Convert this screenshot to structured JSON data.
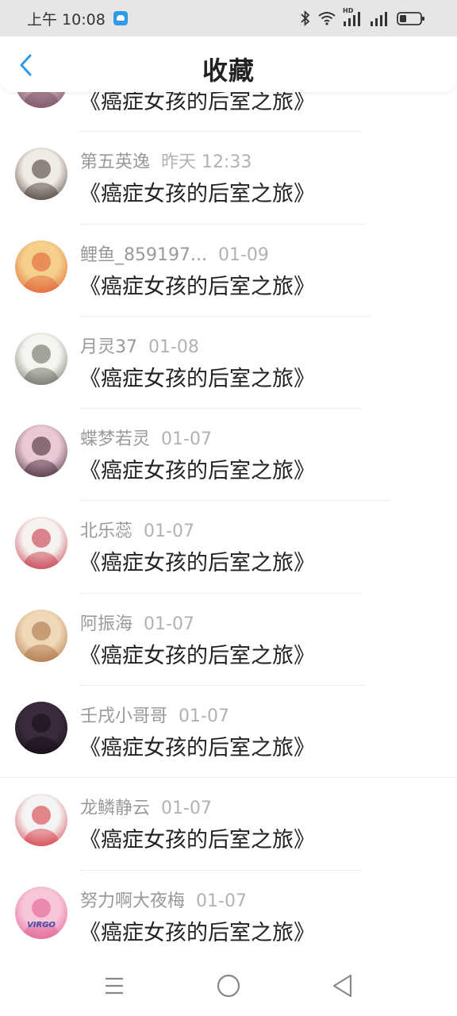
{
  "status_bar": {
    "time": "上午 10:08",
    "icons": [
      "app-notification-icon",
      "bluetooth-icon",
      "wifi-icon",
      "hd-signal-icon",
      "signal-icon",
      "battery-icon"
    ],
    "hd_label": "HD"
  },
  "header": {
    "title": "收藏",
    "back_icon": "chevron-left-icon",
    "accent_color": "#2f9be8"
  },
  "list": {
    "items": [
      {
        "user": "",
        "time": "",
        "title": "《癌症女孩的后室之旅》",
        "avatar_colors": [
          "#c9a6b6",
          "#6e4a5a"
        ]
      },
      {
        "user": "第五英逸",
        "time": "昨天 12:33",
        "title": "《癌症女孩的后室之旅》",
        "avatar_colors": [
          "#f1ebe6",
          "#3b2e2a"
        ]
      },
      {
        "user": "鲤鱼_859197...",
        "time": "01-09",
        "title": "《癌症女孩的后室之旅》",
        "avatar_colors": [
          "#f4d08a",
          "#e0582f"
        ]
      },
      {
        "user": "月灵37",
        "time": "01-08",
        "title": "《癌症女孩的后室之旅》",
        "avatar_colors": [
          "#f5f5f0",
          "#5c5f52"
        ]
      },
      {
        "user": "蝶梦若灵",
        "time": "01-07",
        "title": "《癌症女孩的后室之旅》",
        "avatar_colors": [
          "#e9c9d6",
          "#3a1f2c"
        ]
      },
      {
        "user": "北乐蕊",
        "time": "01-07",
        "title": "《癌症女孩的后室之旅》",
        "avatar_colors": [
          "#f6f2f0",
          "#c0283a"
        ]
      },
      {
        "user": "阿振海",
        "time": "01-07",
        "title": "《癌症女孩的后室之旅》",
        "avatar_colors": [
          "#f0d9b8",
          "#a86b3a"
        ]
      },
      {
        "user": "壬戌小哥哥",
        "time": "01-07",
        "title": "《癌症女孩的后室之旅》",
        "avatar_colors": [
          "#3a2b3c",
          "#120c14"
        ]
      },
      {
        "user": "龙鳞静云",
        "time": "01-07",
        "title": "《癌症女孩的后室之旅》",
        "avatar_colors": [
          "#f4f4f4",
          "#d42a35"
        ]
      },
      {
        "user": "努力啊大夜梅",
        "time": "01-07",
        "title": "《癌症女孩的后室之旅》",
        "avatar_colors": [
          "#f7c6d9",
          "#e05a8e"
        ],
        "avatar_text": "VIRGO"
      }
    ]
  },
  "nav_bar": {
    "buttons": [
      "menu-icon",
      "home-circle-icon",
      "back-triangle-icon"
    ]
  }
}
